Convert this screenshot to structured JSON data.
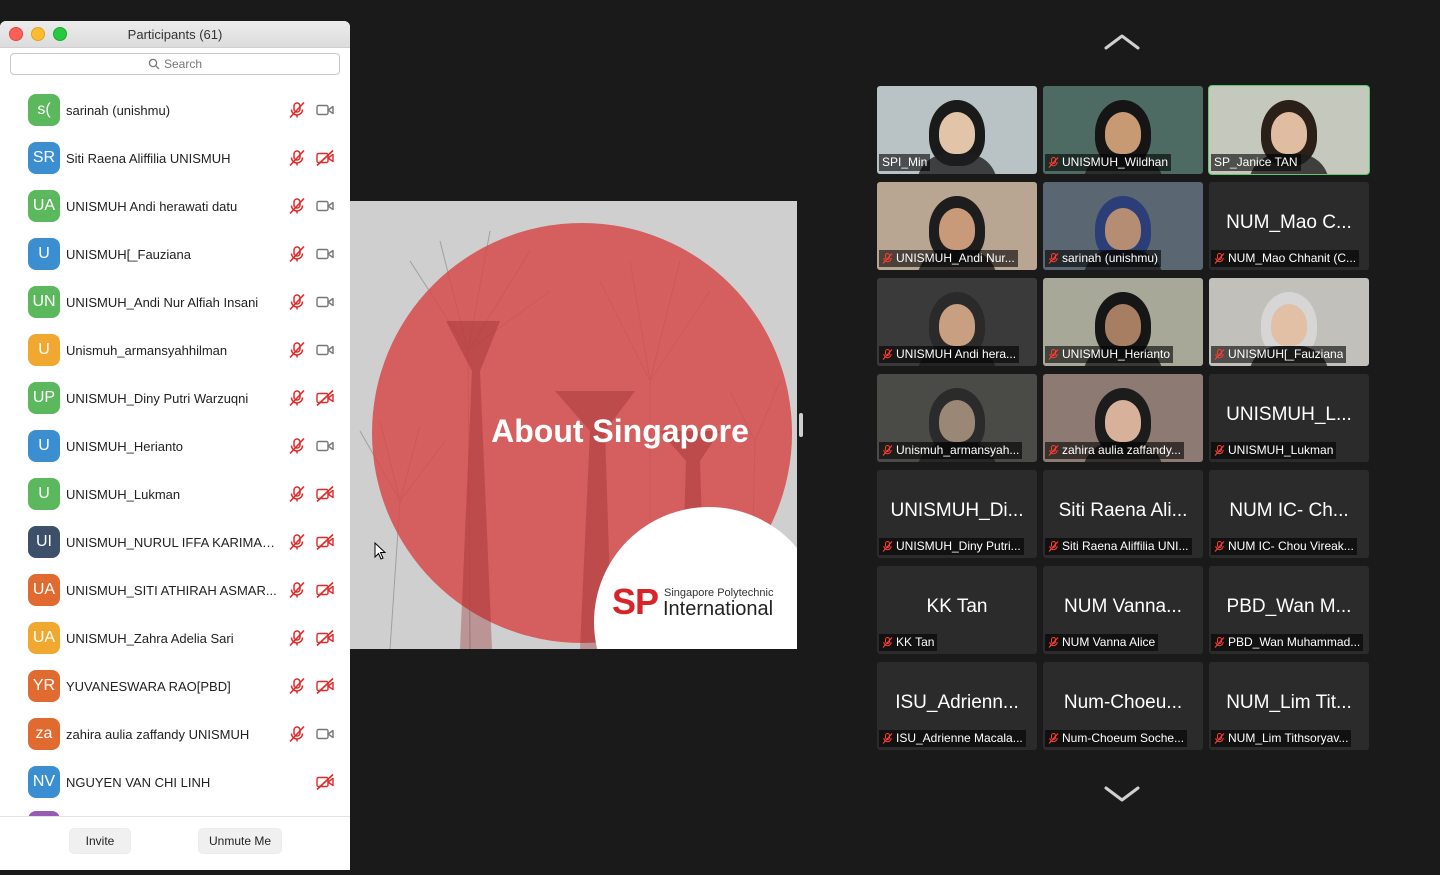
{
  "participants_panel": {
    "title": "Participants (61)",
    "search_placeholder": "Search",
    "participants": [
      {
        "initials": "s(",
        "name": "sarinah (unishmu)",
        "color": "#5cb85c",
        "video_muted": false
      },
      {
        "initials": "SR",
        "name": "Siti Raena Aliffilia UNISMUH",
        "color": "#3b8fd1",
        "video_muted": true
      },
      {
        "initials": "UA",
        "name": "UNISMUH Andi herawati datu",
        "color": "#5cb85c",
        "video_muted": false
      },
      {
        "initials": "U",
        "name": "UNISMUH[_Fauziana",
        "color": "#3b8fd1",
        "video_muted": false
      },
      {
        "initials": "UN",
        "name": "UNISMUH_Andi Nur Alfiah Insani",
        "color": "#5cb85c",
        "video_muted": false
      },
      {
        "initials": "U",
        "name": "Unismuh_armansyahhilman",
        "color": "#f0a830",
        "video_muted": false
      },
      {
        "initials": "UP",
        "name": "UNISMUH_Diny Putri Warzuqni",
        "color": "#5cb85c",
        "video_muted": true
      },
      {
        "initials": "U",
        "name": "UNISMUH_Herianto",
        "color": "#3b8fd1",
        "video_muted": false
      },
      {
        "initials": "U",
        "name": "UNISMUH_Lukman",
        "color": "#5cb85c",
        "video_muted": true
      },
      {
        "initials": "UI",
        "name": "UNISMUH_NURUL IFFA KARIMA_...",
        "color": "#3d5069",
        "video_muted": true
      },
      {
        "initials": "UA",
        "name": "UNISMUH_SITI ATHIRAH ASMAR...",
        "color": "#e06a30",
        "video_muted": true
      },
      {
        "initials": "UA",
        "name": "UNISMUH_Zahra Adelia Sari",
        "color": "#f0a830",
        "video_muted": true
      },
      {
        "initials": "YR",
        "name": "YUVANESWARA RAO[PBD]",
        "color": "#e06a30",
        "video_muted": true
      },
      {
        "initials": "za",
        "name": "zahira aulia zaffandy UNISMUH",
        "color": "#e06a30",
        "video_muted": false
      },
      {
        "initials": "NV",
        "name": "NGUYEN VAN CHI LINH",
        "color": "#3b8fd1",
        "video_muted": true,
        "no_mic": true
      }
    ],
    "invite_label": "Invite",
    "unmute_label": "Unmute Me"
  },
  "slide": {
    "title": "About Singapore",
    "logo_mark": "SP",
    "logo_line1": "Singapore Polytechnic",
    "logo_line2": "International"
  },
  "gallery": [
    {
      "big": "",
      "label": "SPI_Min",
      "video": true,
      "muted": false,
      "active": false,
      "bg": "#b9c3c6",
      "skin": "#e2c4a8",
      "hair": "#1a1a1a"
    },
    {
      "big": "",
      "label": "UNISMUH_Wildhan",
      "video": true,
      "muted": true,
      "active": false,
      "bg": "#4e6b63",
      "skin": "#c89a74",
      "hair": "#151515"
    },
    {
      "big": "",
      "label": "SP_Janice TAN",
      "video": true,
      "muted": false,
      "active": true,
      "bg": "#c4c8bd",
      "skin": "#e0bda0",
      "hair": "#2a2018"
    },
    {
      "big": "",
      "label": "UNISMUH_Andi Nur...",
      "video": true,
      "muted": true,
      "active": false,
      "bg": "#b8a592",
      "skin": "#c99a7a",
      "hair": "#1d1d1d"
    },
    {
      "big": "",
      "label": "sarinah (unishmu)",
      "video": true,
      "muted": true,
      "active": false,
      "bg": "#5a6672",
      "skin": "#b58d72",
      "hair": "#2c3e78"
    },
    {
      "big": "NUM_Mao C...",
      "label": "NUM_Mao Chhanit (C...",
      "video": false,
      "muted": true,
      "active": false
    },
    {
      "big": "",
      "label": "UNISMUH Andi hera...",
      "video": true,
      "muted": true,
      "active": false,
      "bg": "#3a3a3a",
      "skin": "#c89f80",
      "hair": "#2a2a2a"
    },
    {
      "big": "",
      "label": "UNISMUH_Herianto",
      "video": true,
      "muted": true,
      "active": false,
      "bg": "#a7a898",
      "skin": "#a87e62",
      "hair": "#161616"
    },
    {
      "big": "",
      "label": "UNISMUH[_Fauziana",
      "video": true,
      "muted": true,
      "active": false,
      "bg": "#c1c0bb",
      "skin": "#e1c0a6",
      "hair": "#d6d6d6"
    },
    {
      "big": "",
      "label": "Unismuh_armansyah...",
      "video": true,
      "muted": true,
      "active": false,
      "bg": "#4a4a46",
      "skin": "#9b8775",
      "hair": "#2b2b2b"
    },
    {
      "big": "",
      "label": "zahira aulia zaffandy...",
      "video": true,
      "muted": true,
      "active": false,
      "bg": "#8d7a72",
      "skin": "#d7b19a",
      "hair": "#1c1c1c"
    },
    {
      "big": "UNISMUH_L...",
      "label": "UNISMUH_Lukman",
      "video": false,
      "muted": true,
      "active": false
    },
    {
      "big": "UNISMUH_Di...",
      "label": "UNISMUH_Diny Putri...",
      "video": false,
      "muted": true,
      "active": false
    },
    {
      "big": "Siti Raena Ali...",
      "label": "Siti Raena Aliffilia UNI...",
      "video": false,
      "muted": true,
      "active": false
    },
    {
      "big": "NUM IC- Ch...",
      "label": "NUM IC- Chou Vireak...",
      "video": false,
      "muted": true,
      "active": false
    },
    {
      "big": "KK Tan",
      "label": "KK Tan",
      "video": false,
      "muted": true,
      "active": false
    },
    {
      "big": "NUM Vanna...",
      "label": "NUM Vanna Alice",
      "video": false,
      "muted": true,
      "active": false
    },
    {
      "big": "PBD_Wan M...",
      "label": "PBD_Wan Muhammad...",
      "video": false,
      "muted": true,
      "active": false
    },
    {
      "big": "ISU_Adrienn...",
      "label": "ISU_Adrienne Macala...",
      "video": false,
      "muted": true,
      "active": false
    },
    {
      "big": "Num-Choeu...",
      "label": "Num-Choeum Soche...",
      "video": false,
      "muted": true,
      "active": false
    },
    {
      "big": "NUM_Lim Tit...",
      "label": "NUM_Lim Tithsoryav...",
      "video": false,
      "muted": true,
      "active": false
    }
  ]
}
